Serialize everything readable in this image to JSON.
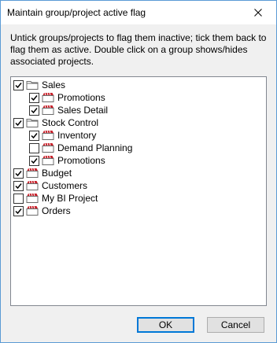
{
  "dialog": {
    "title": "Maintain group/project active flag",
    "instructions": "Untick groups/projects to flag them inactive; tick them back to flag them as active. Double click on a group shows/hides associated projects."
  },
  "tree": {
    "items": [
      {
        "label": "Sales",
        "level": 0,
        "checked": true,
        "kind": "group"
      },
      {
        "label": "Promotions",
        "level": 1,
        "checked": true,
        "kind": "project"
      },
      {
        "label": "Sales Detail",
        "level": 1,
        "checked": true,
        "kind": "project"
      },
      {
        "label": "Stock Control",
        "level": 0,
        "checked": true,
        "kind": "group"
      },
      {
        "label": "Inventory",
        "level": 1,
        "checked": true,
        "kind": "project"
      },
      {
        "label": "Demand Planning",
        "level": 1,
        "checked": false,
        "kind": "project"
      },
      {
        "label": "Promotions",
        "level": 1,
        "checked": true,
        "kind": "project"
      },
      {
        "label": "Budget",
        "level": 0,
        "checked": true,
        "kind": "project"
      },
      {
        "label": "Customers",
        "level": 0,
        "checked": true,
        "kind": "project"
      },
      {
        "label": "My BI Project",
        "level": 0,
        "checked": false,
        "kind": "project"
      },
      {
        "label": "Orders",
        "level": 0,
        "checked": true,
        "kind": "project"
      }
    ]
  },
  "buttons": {
    "ok_label": "OK",
    "cancel_label": "Cancel"
  },
  "icons": {
    "group": "folder-icon",
    "project": "project-icon",
    "close": "close-icon"
  },
  "colors": {
    "accent": "#0078d7",
    "project_icon_red": "#c8202a"
  }
}
